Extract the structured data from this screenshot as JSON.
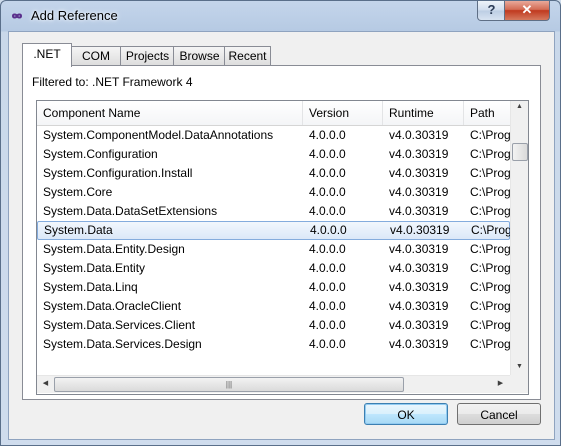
{
  "window": {
    "title": "Add Reference",
    "help_label": "?",
    "close_label": "✕"
  },
  "tabs": [
    {
      "label": ".NET",
      "active": true
    },
    {
      "label": "COM",
      "active": false
    },
    {
      "label": "Projects",
      "active": false
    },
    {
      "label": "Browse",
      "active": false
    },
    {
      "label": "Recent",
      "active": false
    }
  ],
  "filter_label": "Filtered to: .NET Framework 4",
  "list": {
    "columns": [
      "Component Name",
      "Version",
      "Runtime",
      "Path"
    ],
    "selected_index": 5,
    "rows": [
      [
        "System.ComponentModel.DataAnnotations",
        "4.0.0.0",
        "v4.0.30319",
        "C:\\Prog"
      ],
      [
        "System.Configuration",
        "4.0.0.0",
        "v4.0.30319",
        "C:\\Prog"
      ],
      [
        "System.Configuration.Install",
        "4.0.0.0",
        "v4.0.30319",
        "C:\\Prog"
      ],
      [
        "System.Core",
        "4.0.0.0",
        "v4.0.30319",
        "C:\\Prog"
      ],
      [
        "System.Data.DataSetExtensions",
        "4.0.0.0",
        "v4.0.30319",
        "C:\\Prog"
      ],
      [
        "System.Data",
        "4.0.0.0",
        "v4.0.30319",
        "C:\\Prog"
      ],
      [
        "System.Data.Entity.Design",
        "4.0.0.0",
        "v4.0.30319",
        "C:\\Prog"
      ],
      [
        "System.Data.Entity",
        "4.0.0.0",
        "v4.0.30319",
        "C:\\Prog"
      ],
      [
        "System.Data.Linq",
        "4.0.0.0",
        "v4.0.30319",
        "C:\\Prog"
      ],
      [
        "System.Data.OracleClient",
        "4.0.0.0",
        "v4.0.30319",
        "C:\\Prog"
      ],
      [
        "System.Data.Services.Client",
        "4.0.0.0",
        "v4.0.30319",
        "C:\\Prog"
      ],
      [
        "System.Data.Services.Design",
        "4.0.0.0",
        "v4.0.30319",
        "C:\\Prog"
      ]
    ]
  },
  "buttons": {
    "ok": "OK",
    "cancel": "Cancel"
  },
  "icons": {
    "app": "infinity-icon",
    "scroll_up": "scroll-up-arrow-icon",
    "scroll_down": "scroll-down-arrow-icon",
    "scroll_left": "scroll-left-arrow-icon",
    "scroll_right": "scroll-right-arrow-icon"
  }
}
